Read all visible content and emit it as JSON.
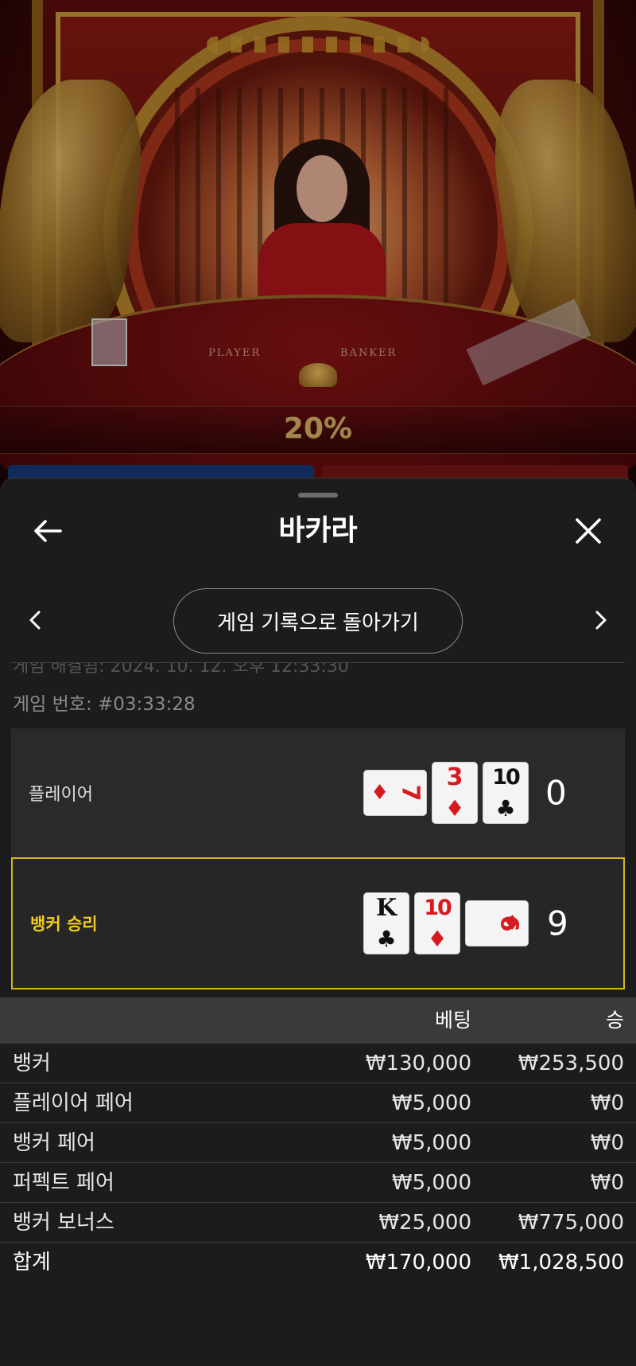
{
  "video": {
    "table_labels": {
      "player": "PLAYER",
      "banker": "BANKER"
    },
    "overlay_percent": "20%"
  },
  "header": {
    "title": "바카라",
    "back_icon": "arrow-left-icon",
    "close_icon": "close-icon"
  },
  "navigation": {
    "prev_icon": "chevron-left-icon",
    "next_icon": "chevron-right-icon",
    "back_to_history_label": "게임 기록으로 돌아가기"
  },
  "game": {
    "settled_partial": "게임 해결됨: 2024. 10. 12. 오후 12:33:30",
    "game_number": "게임 번호: #03:33:28"
  },
  "hands": {
    "player": {
      "label": "플레이어",
      "total": "0",
      "cards": [
        {
          "rank": "7",
          "suit": "♦",
          "color": "red",
          "orientation": "horizontal"
        },
        {
          "rank": "3",
          "suit": "♦",
          "color": "red",
          "orientation": "vertical"
        },
        {
          "rank": "10",
          "suit": "♣",
          "color": "black",
          "orientation": "vertical"
        }
      ]
    },
    "banker": {
      "label": "뱅커 승리",
      "total": "9",
      "cards": [
        {
          "rank": "K",
          "suit": "♣",
          "color": "black",
          "orientation": "vertical"
        },
        {
          "rank": "10",
          "suit": "♦",
          "color": "red",
          "orientation": "vertical"
        },
        {
          "rank": "9",
          "suit": "♦",
          "color": "red",
          "orientation": "horizontal"
        }
      ],
      "highlight_color": "#d8b818"
    }
  },
  "bets_table": {
    "headers": {
      "bet": "베팅",
      "win": "승"
    },
    "rows": [
      {
        "name": "뱅커",
        "bet": "₩130,000",
        "win": "₩253,500"
      },
      {
        "name": "플레이어 페어",
        "bet": "₩5,000",
        "win": "₩0"
      },
      {
        "name": "뱅커 페어",
        "bet": "₩5,000",
        "win": "₩0"
      },
      {
        "name": "퍼펙트 페어",
        "bet": "₩5,000",
        "win": "₩0"
      },
      {
        "name": "뱅커 보너스",
        "bet": "₩25,000",
        "win": "₩775,000"
      }
    ],
    "total": {
      "name": "합계",
      "bet": "₩170,000",
      "win": "₩1,028,500"
    }
  },
  "colors": {
    "sheet_bg": "#1c1c1c",
    "panel_bg": "#2a2a2a",
    "table_header_bg": "#3a3a3a",
    "winner_yellow": "#f2cc1c",
    "card_red": "#d61b20"
  }
}
